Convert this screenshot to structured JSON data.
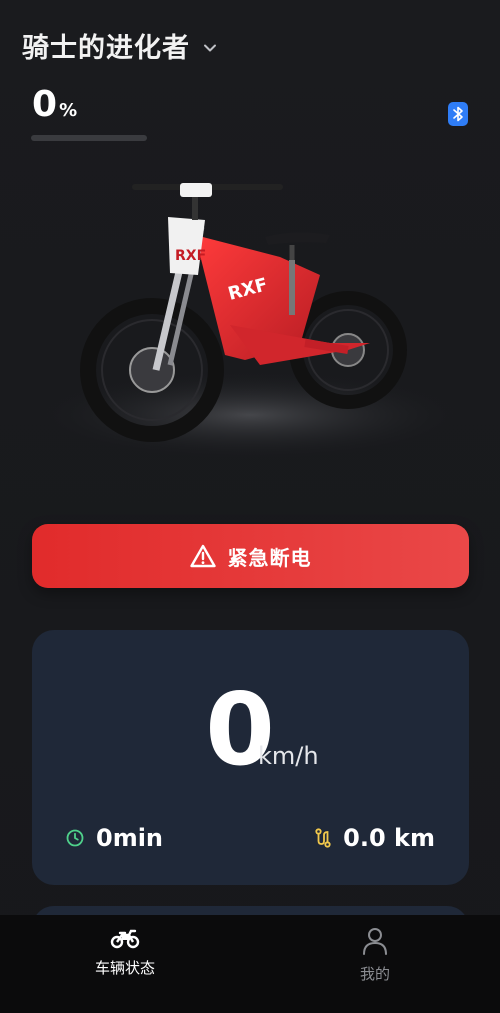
{
  "header": {
    "title": "骑士的进化者"
  },
  "battery": {
    "value": "0",
    "unit": "%",
    "level_percent": 0
  },
  "emergency_button": {
    "label": "紧急断电"
  },
  "speed": {
    "value": "0",
    "unit": "km/h"
  },
  "stats": {
    "duration": "0min",
    "distance": "0.0 km"
  },
  "nav": {
    "items": [
      {
        "label": "车辆状态",
        "icon": "motorcycle-icon",
        "active": true
      },
      {
        "label": "我的",
        "icon": "user-icon",
        "active": false
      }
    ]
  },
  "colors": {
    "accent_red": "#e3302f",
    "card_bg": "#1f2838",
    "bluetooth": "#2f7df6",
    "clock_icon": "#4fd18b",
    "route_icon": "#f2c94c"
  }
}
